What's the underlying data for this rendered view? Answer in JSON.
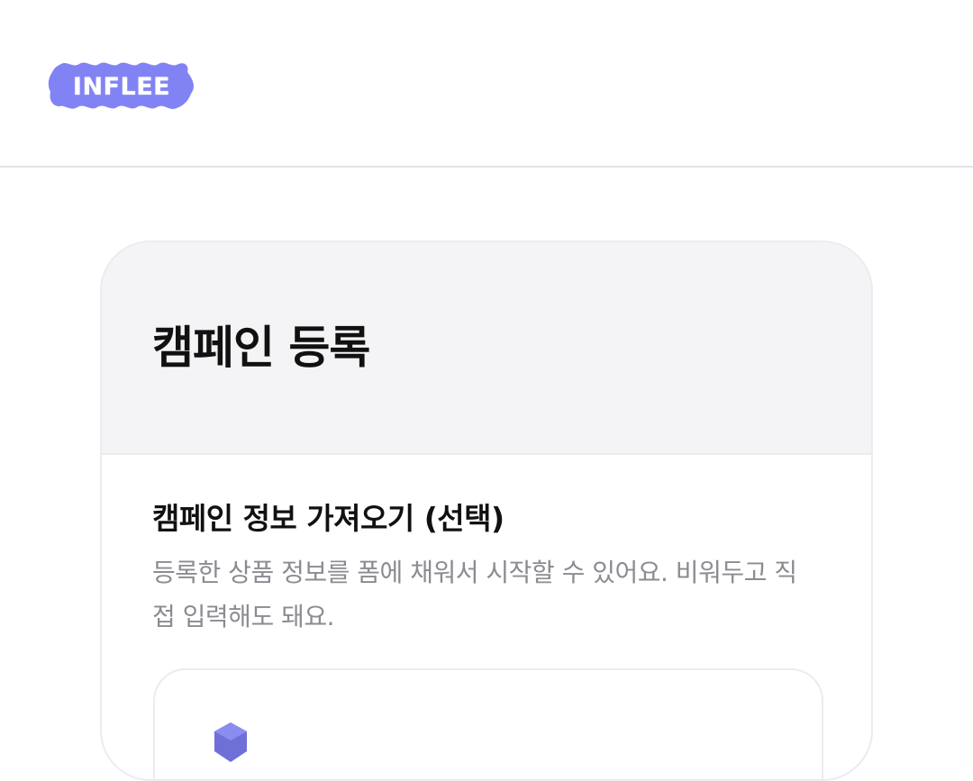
{
  "header": {
    "logo_text": "INFLEE",
    "brand_color": "#8183f4"
  },
  "card": {
    "title": "캠페인 등록",
    "section": {
      "title": "캠페인 정보 가져오기 (선택)",
      "description": "등록한 상품 정보를 폼에 채워서 시작할 수 있어요. 비워두고 직접 입력해도 돼요."
    },
    "import_box": {
      "icon": "tag-icon"
    }
  },
  "colors": {
    "text_primary": "#111111",
    "text_secondary": "#8b8b92",
    "card_head_bg": "#f4f4f6",
    "border": "#ececef"
  }
}
